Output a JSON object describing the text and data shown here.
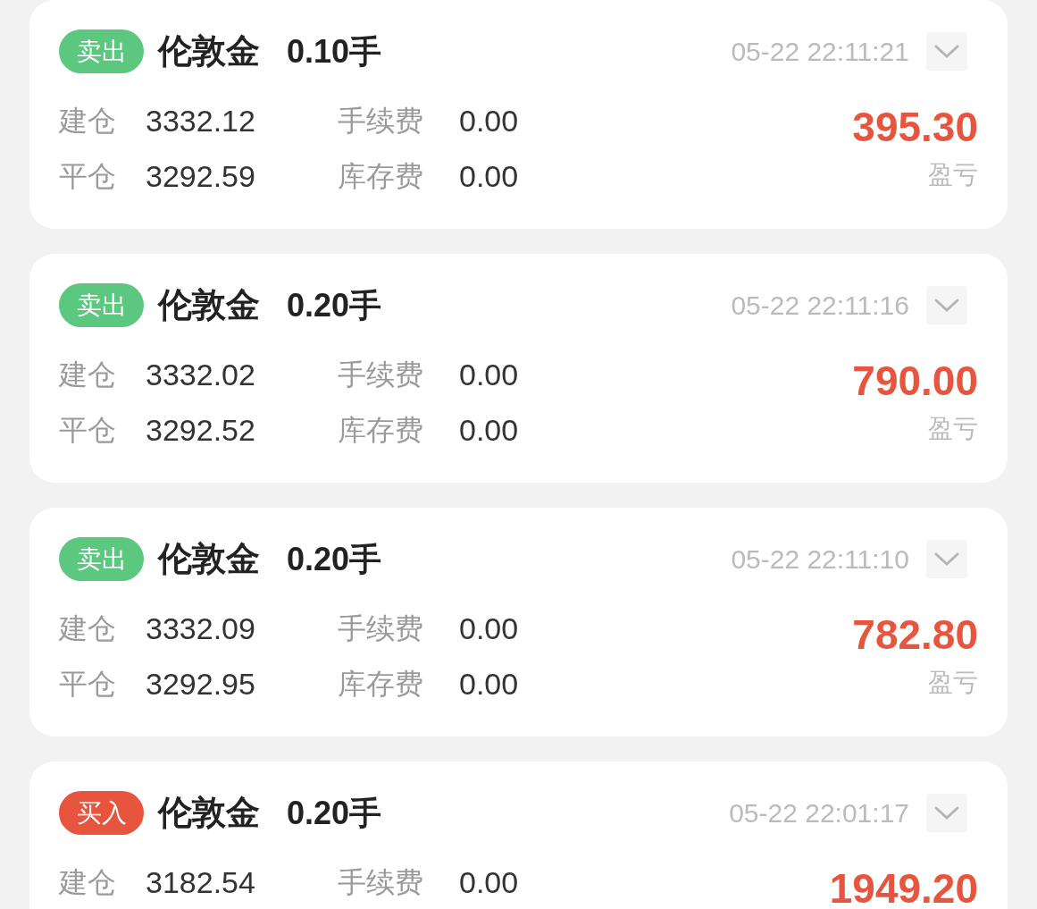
{
  "trades": [
    {
      "side": {
        "kind": "sell",
        "label": "卖出"
      },
      "symbol": "伦敦金",
      "lots": "0.10手",
      "time": "05-22 22:11:21",
      "details": [
        {
          "label": "建仓",
          "value": "3332.12"
        },
        {
          "label": "手续费",
          "value": "0.00"
        },
        {
          "label": "平仓",
          "value": "3292.59"
        },
        {
          "label": "库存费",
          "value": "0.00"
        }
      ],
      "profit": "395.30",
      "profit_label": "盈亏"
    },
    {
      "side": {
        "kind": "sell",
        "label": "卖出"
      },
      "symbol": "伦敦金",
      "lots": "0.20手",
      "time": "05-22 22:11:16",
      "details": [
        {
          "label": "建仓",
          "value": "3332.02"
        },
        {
          "label": "手续费",
          "value": "0.00"
        },
        {
          "label": "平仓",
          "value": "3292.52"
        },
        {
          "label": "库存费",
          "value": "0.00"
        }
      ],
      "profit": "790.00",
      "profit_label": "盈亏"
    },
    {
      "side": {
        "kind": "sell",
        "label": "卖出"
      },
      "symbol": "伦敦金",
      "lots": "0.20手",
      "time": "05-22 22:11:10",
      "details": [
        {
          "label": "建仓",
          "value": "3332.09"
        },
        {
          "label": "手续费",
          "value": "0.00"
        },
        {
          "label": "平仓",
          "value": "3292.95"
        },
        {
          "label": "库存费",
          "value": "0.00"
        }
      ],
      "profit": "782.80",
      "profit_label": "盈亏"
    },
    {
      "side": {
        "kind": "buy",
        "label": "买入"
      },
      "symbol": "伦敦金",
      "lots": "0.20手",
      "time": "05-22 22:01:17",
      "details": [
        {
          "label": "建仓",
          "value": "3182.54"
        },
        {
          "label": "手续费",
          "value": "0.00"
        }
      ],
      "profit": "1949.20"
    }
  ]
}
